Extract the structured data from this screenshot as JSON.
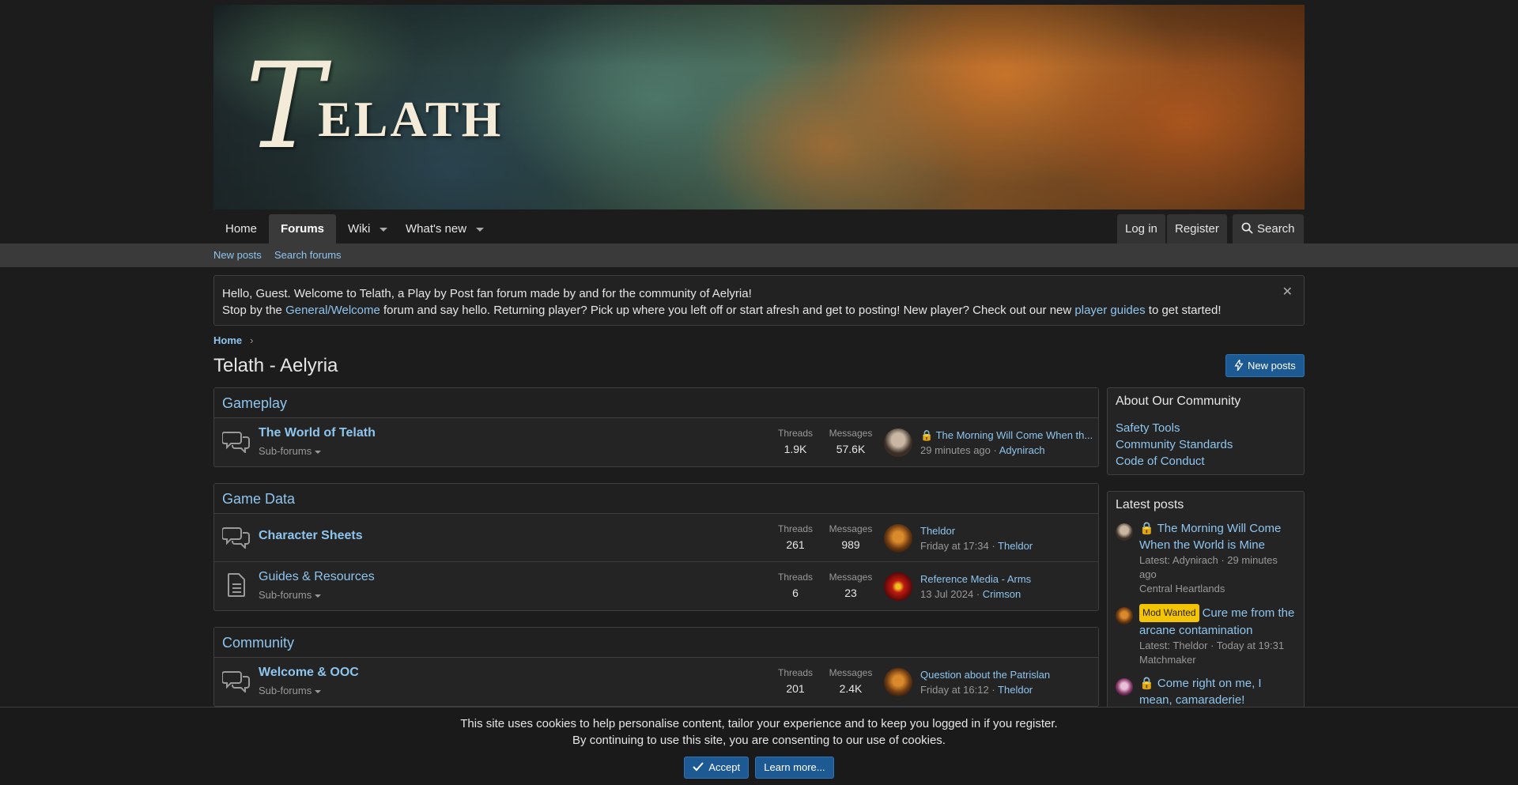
{
  "brand": {
    "logo_initial": "T",
    "logo_rest": "ELATH"
  },
  "nav": {
    "home": "Home",
    "forums": "Forums",
    "wiki": "Wiki",
    "whats_new": "What's new",
    "login": "Log in",
    "register": "Register",
    "search": "Search"
  },
  "subnav": {
    "new_posts": "New posts",
    "search_forums": "Search forums"
  },
  "notice": {
    "line1": "Hello, Guest. Welcome to Telath, a Play by Post fan forum made by and for the community of Aelyria!",
    "line2_pre": "Stop by the ",
    "line2_link1": "General/Welcome",
    "line2_mid": " forum and say hello. Returning player? Pick up where you left off or start afresh and get to posting! New player? Check out our new ",
    "line2_link2": "player guides",
    "line2_post": " to get started!",
    "close": "✕"
  },
  "breadcrumb": {
    "home": "Home",
    "sep": "›"
  },
  "page": {
    "title": "Telath - Aelyria",
    "new_posts_button": "New posts"
  },
  "labels": {
    "threads": "Threads",
    "messages": "Messages",
    "subforums": "Sub-forums"
  },
  "categories": [
    {
      "title": "Gameplay",
      "nodes": [
        {
          "title": "The World of Telath",
          "threads": "1.9K",
          "messages": "57.6K",
          "last_title": "🔒 The Morning Will Come When th...",
          "last_time": "29 minutes ago",
          "last_user": "Adynirach"
        }
      ]
    },
    {
      "title": "Game Data",
      "nodes": [
        {
          "title": "Character Sheets",
          "threads": "261",
          "messages": "989",
          "last_title": "Theldor",
          "last_time": "Friday at 17:34",
          "last_user": "Theldor"
        },
        {
          "title": "Guides & Resources",
          "threads": "6",
          "messages": "23",
          "last_title": "Reference Media - Arms",
          "last_time": "13 Jul 2024",
          "last_user": "Crimson"
        }
      ]
    },
    {
      "title": "Community",
      "nodes": [
        {
          "title": "Welcome & OOC",
          "threads": "201",
          "messages": "2.4K",
          "last_title": "Question about the Patrislan",
          "last_time": "Friday at 16:12",
          "last_user": "Theldor"
        }
      ]
    }
  ],
  "sidebar": {
    "about_title": "About Our Community",
    "links": [
      "Safety Tools",
      "Community Standards",
      "Code of Conduct"
    ],
    "latest_title": "Latest posts",
    "latest": [
      {
        "prefix": "🔒 ",
        "title": "The Morning Will Come When the World is Mine",
        "meta": "Latest: Adynirach · 29 minutes ago",
        "forum": "Central Heartlands"
      },
      {
        "badge": "Mod Wanted",
        "title": "Cure me from the arcane contamination",
        "meta": "Latest: Theldor · Today at 19:31",
        "forum": "Matchmaker"
      },
      {
        "prefix": "🔒 ",
        "title": "Come right on me, I mean, camaraderie!"
      }
    ]
  },
  "cookie": {
    "line1": "This site uses cookies to help personalise content, tailor your experience and to keep you logged in if you register.",
    "line2": "By continuing to use this site, you are consenting to our use of cookies.",
    "accept": "Accept",
    "learn_more": "Learn more..."
  },
  "colors": {
    "link": "#8ec5ee",
    "button": "#1d5a93",
    "badge": "#f5c400"
  }
}
